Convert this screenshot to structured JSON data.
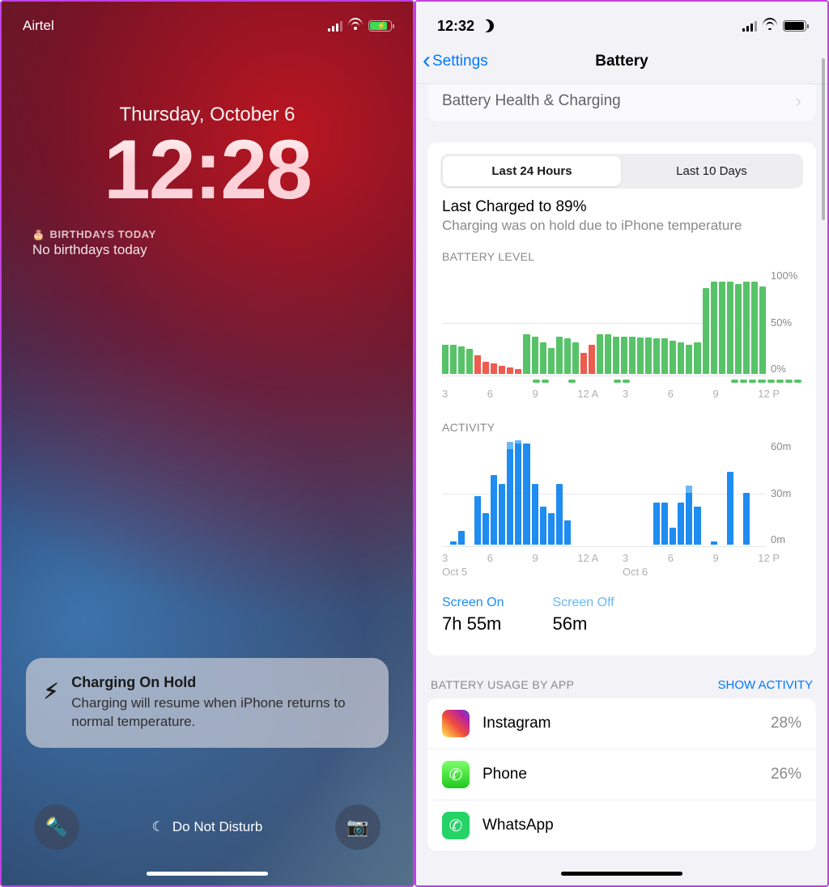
{
  "left": {
    "carrier": "Airtel",
    "date": "Thursday, October 6",
    "time": "12:28",
    "widget": {
      "heading": "BIRTHDAYS TODAY",
      "value": "No birthdays today"
    },
    "notification": {
      "title": "Charging On Hold",
      "body": "Charging will resume when iPhone returns to normal temperature."
    },
    "dnd_label": "Do Not Disturb"
  },
  "right": {
    "status_time": "12:32",
    "nav": {
      "back": "Settings",
      "title": "Battery"
    },
    "peek_row": "Battery Health & Charging",
    "tabs": {
      "a": "Last 24 Hours",
      "b": "Last 10 Days"
    },
    "last_charged": {
      "title": "Last Charged to 89%",
      "subtitle": "Charging was on hold due to iPhone temperature"
    },
    "sections": {
      "battery_level": "BATTERY LEVEL",
      "activity": "ACTIVITY",
      "usage_by_app": "BATTERY USAGE BY APP",
      "show_activity": "SHOW ACTIVITY"
    },
    "legend": {
      "screen_on": {
        "label": "Screen On",
        "value": "7h 55m"
      },
      "screen_off": {
        "label": "Screen Off",
        "value": "56m"
      }
    },
    "apps": [
      {
        "name": "Instagram",
        "pct": "28%",
        "icon": "instagram"
      },
      {
        "name": "Phone",
        "pct": "26%",
        "icon": "phone"
      },
      {
        "name": "WhatsApp",
        "pct": "",
        "icon": "whatsapp"
      }
    ],
    "axis": {
      "battery_y": [
        "100%",
        "50%",
        "0%"
      ],
      "activity_y": [
        "60m",
        "30m",
        "0m"
      ],
      "x_ticks": [
        "3",
        "6",
        "9",
        "12 A",
        "3",
        "6",
        "9",
        "12 P"
      ],
      "day_labels": [
        "Oct 5",
        "Oct 6"
      ]
    }
  },
  "chart_data": [
    {
      "type": "bar",
      "name": "battery_level",
      "title": "BATTERY LEVEL",
      "ylabel": "%",
      "ylim": [
        0,
        100
      ],
      "x_ticks": [
        "3",
        "6",
        "9",
        "12 A",
        "3",
        "6",
        "9",
        "12 P"
      ],
      "values": [
        28,
        28,
        26,
        24,
        18,
        12,
        10,
        8,
        6,
        5,
        38,
        36,
        30,
        25,
        36,
        34,
        30,
        20,
        28,
        38,
        38,
        36,
        36,
        36,
        35,
        35,
        34,
        34,
        32,
        30,
        28,
        30,
        82,
        88,
        88,
        88,
        86,
        88,
        88,
        84
      ],
      "low_power_indices": [
        4,
        5,
        6,
        7,
        8,
        9,
        17,
        18
      ],
      "charging_indices": [
        10,
        11,
        14,
        19,
        20,
        32,
        33,
        34,
        35,
        36,
        37,
        38,
        39
      ]
    },
    {
      "type": "bar",
      "name": "activity",
      "title": "ACTIVITY",
      "ylabel": "minutes",
      "ylim": [
        0,
        60
      ],
      "x_ticks": [
        "3",
        "6",
        "9",
        "12 A",
        "3",
        "6",
        "9",
        "12 P"
      ],
      "series": [
        {
          "name": "Screen On",
          "values": [
            0,
            2,
            8,
            0,
            28,
            18,
            40,
            35,
            55,
            58,
            58,
            35,
            22,
            18,
            35,
            14,
            0,
            0,
            0,
            0,
            0,
            0,
            0,
            0,
            0,
            0,
            24,
            24,
            10,
            24,
            30,
            22,
            0,
            2,
            0,
            42,
            0,
            30,
            0,
            0
          ]
        },
        {
          "name": "Screen Off",
          "values": [
            0,
            0,
            0,
            0,
            0,
            0,
            0,
            0,
            4,
            2,
            0,
            0,
            0,
            0,
            0,
            0,
            0,
            0,
            0,
            0,
            0,
            0,
            0,
            0,
            0,
            0,
            0,
            0,
            0,
            0,
            4,
            0,
            0,
            0,
            0,
            0,
            0,
            0,
            0,
            0
          ]
        }
      ]
    }
  ]
}
